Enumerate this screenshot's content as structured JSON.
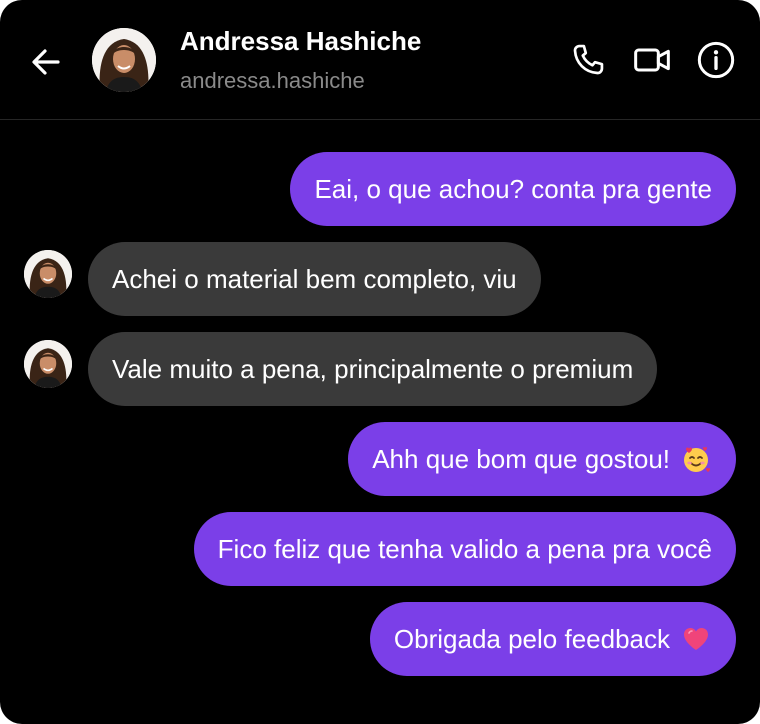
{
  "header": {
    "name": "Andressa Hashiche",
    "handle": "andressa.hashiche",
    "icons": [
      "back-arrow-icon",
      "phone-icon",
      "video-camera-icon",
      "info-icon"
    ]
  },
  "messages": [
    {
      "side": "sent",
      "text": "Eai, o que achou? conta pra gente"
    },
    {
      "side": "received",
      "text": "Achei o material bem completo, viu"
    },
    {
      "side": "received",
      "text": "Vale muito a pena, principalmente o premium"
    },
    {
      "side": "sent",
      "text": "Ahh que bom que gostou!",
      "emoji": "smiling-face-with-hearts"
    },
    {
      "side": "sent",
      "text": "Fico feliz que tenha valido a pena pra você"
    },
    {
      "side": "sent",
      "text": "Obrigada pelo feedback",
      "emoji": "heart"
    }
  ],
  "colors": {
    "background": "#000000",
    "sent_bubble": "#7b3fe8",
    "received_bubble": "#3a3a3a",
    "handle_text": "#8a8a8a"
  }
}
